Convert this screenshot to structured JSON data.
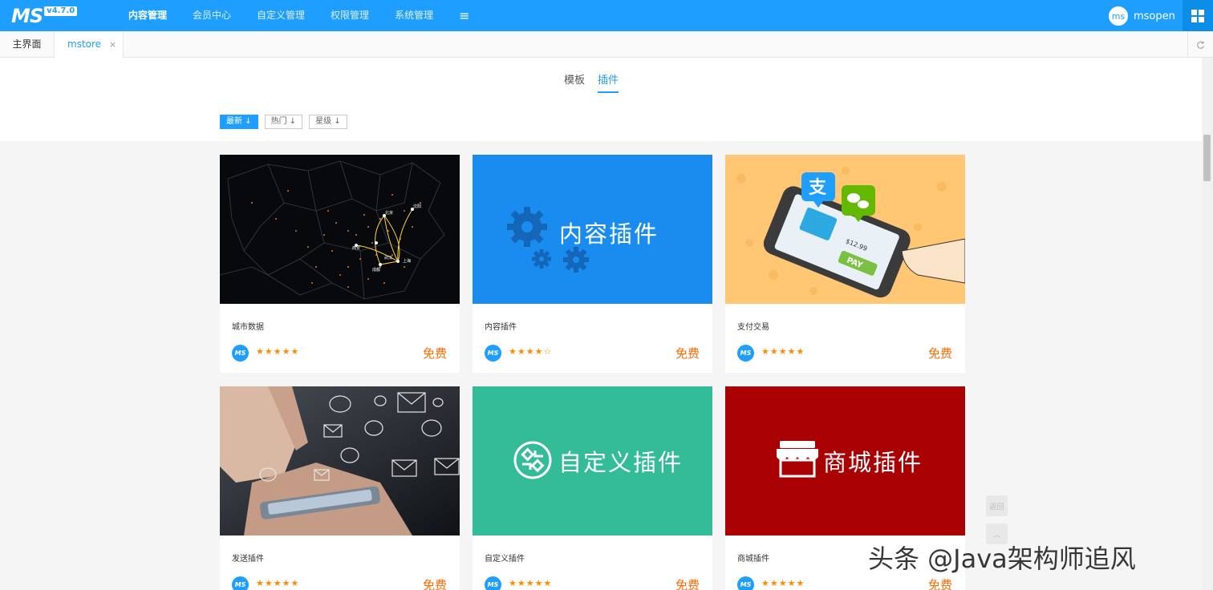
{
  "app": {
    "logo_text": "MS",
    "version": "v4.7.0"
  },
  "nav": {
    "items": [
      "内容管理",
      "会员中心",
      "自定义管理",
      "权限管理",
      "系统管理"
    ],
    "menu_icon": "≡"
  },
  "user": {
    "avatar_text": "ms",
    "name": "msopen"
  },
  "tabs": {
    "home": "主界面",
    "mstore": "mstore",
    "close": "×"
  },
  "type_tabs": [
    "模板",
    "插件"
  ],
  "sort": {
    "newest": "最新",
    "hot": "热门",
    "stars": "星级",
    "arrow": "↓"
  },
  "cards": [
    {
      "name": "城市数据",
      "rating": "★★★★★",
      "price": "免费",
      "image_title": ""
    },
    {
      "name": "内容插件",
      "rating": "★★★★☆",
      "price": "免费",
      "image_title": "内容插件"
    },
    {
      "name": "支付交易",
      "rating": "★★★★★",
      "price": "免费",
      "image_title": ""
    },
    {
      "name": "发送插件",
      "rating": "★★★★★",
      "price": "免费",
      "image_title": ""
    },
    {
      "name": "自定义插件",
      "rating": "★★★★★",
      "price": "免费",
      "image_title": "自定义插件"
    },
    {
      "name": "商城插件",
      "rating": "★★★★★",
      "price": "免费",
      "image_title": "商城插件"
    }
  ],
  "card_logo_text": "MS",
  "side": {
    "back": "返回",
    "top": "︿"
  },
  "map_labels": [
    "北京",
    "沈阳",
    "西安",
    "成都",
    "武汉",
    "上海"
  ],
  "pay_price": "$12.99",
  "pay_label": "PAY",
  "watermark": "头条 @Java架构师追风",
  "colors": {
    "primary": "#1e9fff",
    "content_plugin_bg": "#1a8cf0",
    "pay_bg": "#ffc774",
    "custom_plugin_bg": "#34bc98",
    "shop_plugin_bg": "#a90004",
    "price": "#ff6a00",
    "star": "#ff8c00"
  }
}
